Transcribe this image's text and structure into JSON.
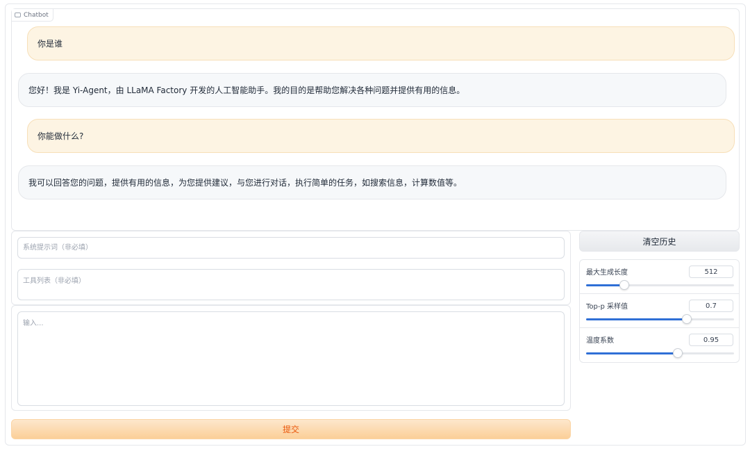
{
  "chatbot": {
    "label": "Chatbot",
    "messages": [
      {
        "role": "user",
        "text": "你是谁"
      },
      {
        "role": "bot",
        "text": "您好！我是 Yi-Agent，由 LLaMA Factory 开发的人工智能助手。我的目的是帮助您解决各种问题并提供有用的信息。"
      },
      {
        "role": "user",
        "text": "你能做什么?"
      },
      {
        "role": "bot",
        "text": "我可以回答您的问题，提供有用的信息，为您提供建议，与您进行对话，执行简单的任务，如搜索信息，计算数值等。"
      }
    ]
  },
  "inputs": {
    "system_placeholder": "系统提示词（非必填）",
    "tools_placeholder": "工具列表（非必填）",
    "query_placeholder": "输入..."
  },
  "submit_label": "提交",
  "clear_label": "清空历史",
  "sliders": [
    {
      "label": "最大生成长度",
      "value": "512",
      "fraction": 0.26
    },
    {
      "label": "Top-p 采样值",
      "value": "0.7",
      "fraction": 0.68
    },
    {
      "label": "温度系数",
      "value": "0.95",
      "fraction": 0.62
    }
  ],
  "colors": {
    "accent": "#2f6fd6",
    "submit_text": "#ea580c",
    "user_bubble": "#fdf4e3",
    "bot_bubble": "#f6f8fa"
  }
}
